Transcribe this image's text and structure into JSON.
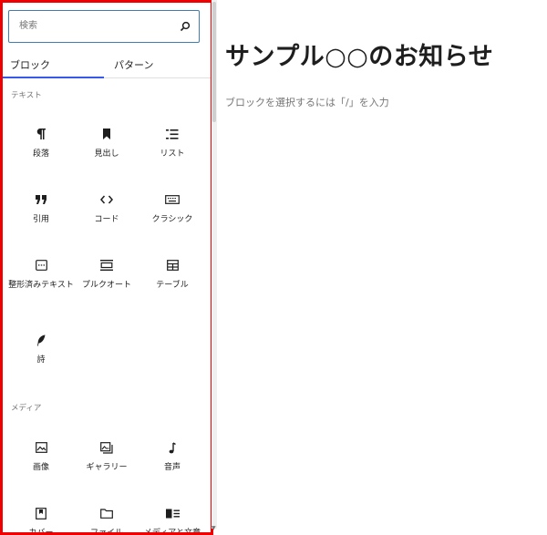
{
  "search": {
    "placeholder": "検索"
  },
  "tabs": [
    {
      "label": "ブロック",
      "active": true
    },
    {
      "label": "パターン",
      "active": false
    }
  ],
  "categories": {
    "text": {
      "title": "テキスト",
      "blocks": [
        {
          "label": "段落",
          "icon": "paragraph-icon"
        },
        {
          "label": "見出し",
          "icon": "bookmark-icon"
        },
        {
          "label": "リスト",
          "icon": "list-icon"
        },
        {
          "label": "引用",
          "icon": "quote-icon"
        },
        {
          "label": "コード",
          "icon": "code-icon"
        },
        {
          "label": "クラシック",
          "icon": "keyboard-icon"
        },
        {
          "label": "整形済みテキスト",
          "icon": "preformatted-icon"
        },
        {
          "label": "プルクオート",
          "icon": "pullquote-icon"
        },
        {
          "label": "テーブル",
          "icon": "table-icon"
        },
        {
          "label": "詩",
          "icon": "feather-icon"
        }
      ]
    },
    "media": {
      "title": "メディア",
      "blocks": [
        {
          "label": "画像",
          "icon": "image-icon"
        },
        {
          "label": "ギャラリー",
          "icon": "gallery-icon"
        },
        {
          "label": "音声",
          "icon": "music-note-icon"
        },
        {
          "label": "カバー",
          "icon": "cover-icon"
        },
        {
          "label": "ファイル",
          "icon": "folder-icon"
        },
        {
          "label": "メディアと文章",
          "icon": "media-text-icon"
        }
      ]
    }
  },
  "editor": {
    "title": "サンプル○○のお知らせ",
    "hint": "ブロックを選択するには「/」を入力"
  },
  "colors": {
    "highlight_border": "#f00000",
    "search_border": "#3d7fb3",
    "tab_accent": "#3858e9"
  }
}
